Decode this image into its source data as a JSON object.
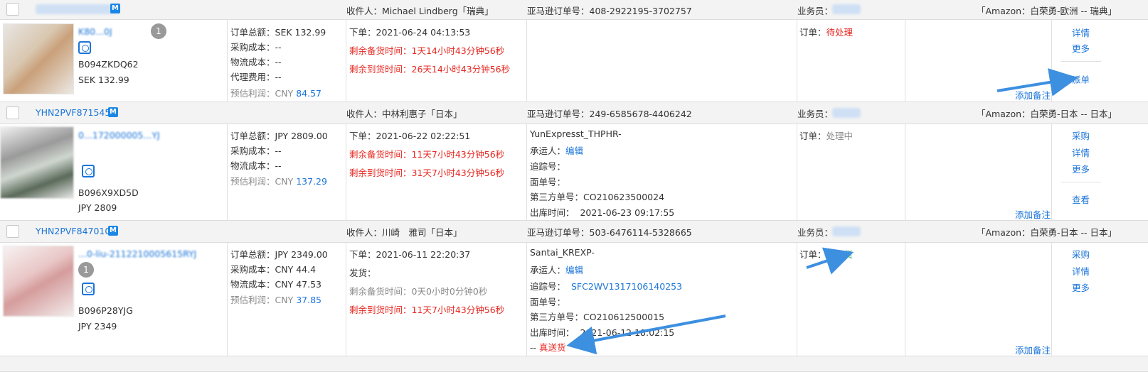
{
  "colors": {
    "link": "#1a74d8",
    "alert": "#e6261f",
    "shipped": "#3cb34a",
    "header_bg": "#f3f3f3",
    "arrow": "#3d8fe0"
  },
  "orders": [
    {
      "header": {
        "order_id": "",
        "recipient": "收件人：Michael Lindberg「瑞典」",
        "amazon_no": "亚马逊订单号：408-2922195-3702757",
        "salesman": "业务员：",
        "shop": "「Amazon：白荣勇-欧洲 -- 瑞典」"
      },
      "product": {
        "title": "K80...0J",
        "count": "1",
        "asin": "B094ZKDQ62",
        "price": "SEK 132.99"
      },
      "money": [
        {
          "label": "订单总额：",
          "value": "SEK 132.99"
        },
        {
          "label": "采购成本：",
          "value": "--"
        },
        {
          "label": "物流成本：",
          "value": "--"
        },
        {
          "label": "代理费用：",
          "value": "--"
        },
        {
          "label": "预估利润：",
          "value": "CNY ",
          "link": "84.57"
        }
      ],
      "time": [
        {
          "text": "下单：2021-06-24 04:13:53",
          "style": "normal"
        },
        {
          "text": "剩余备货时间：1天14小时43分钟56秒",
          "style": "red"
        },
        {
          "text": "剩余到货时间：26天14小时43分钟56秒",
          "style": "red"
        }
      ],
      "status": {
        "label": "订单：",
        "value": "待处理"
      },
      "actions": [
        "详情",
        "更多",
        "派单"
      ],
      "note": "添加备注"
    },
    {
      "header": {
        "order_id": "YHN2PVF871545",
        "recipient": "收件人：中林利惠子「日本」",
        "amazon_no": "亚马逊订单号：249-6585678-4406242",
        "salesman": "业务员：",
        "shop": "「Amazon：白荣勇-日本 -- 日本」"
      },
      "product": {
        "title": "0...172000005...YJ",
        "count": "",
        "asin": "B096X9XD5D",
        "price": "JPY 2809"
      },
      "money": [
        {
          "label": "订单总额：",
          "value": "JPY 2809.00"
        },
        {
          "label": "采购成本：",
          "value": "--"
        },
        {
          "label": "物流成本：",
          "value": "--"
        },
        {
          "label": "预估利润：",
          "value": "CNY ",
          "link": "137.29"
        }
      ],
      "time": [
        {
          "text": "下单：2021-06-22 02:22:51",
          "style": "normal"
        },
        {
          "text": "剩余备货时间：11天7小时43分钟56秒",
          "style": "red"
        },
        {
          "text": "剩余到货时间：31天7小时43分钟56秒",
          "style": "red"
        }
      ],
      "logistics": {
        "carrier_code": "YunExpresst_THPHR-",
        "carrier_label": "承运人：",
        "carrier_edit": "编辑",
        "tracking_label": "追踪号：",
        "tracking": "",
        "face_label": "面单号：",
        "third_label": "第三方单号：",
        "third": "CO210623500024",
        "out_label": "出库时间：",
        "out": "2021-06-23 09:17:55"
      },
      "status": {
        "label": "订单：",
        "value": "处理中"
      },
      "actions": [
        "采购",
        "详情",
        "更多",
        "查看"
      ],
      "note": "添加备注"
    },
    {
      "header": {
        "order_id": "YHN2PVF847010",
        "recipient": "收件人：川崎　雅司「日本」",
        "amazon_no": "亚马逊订单号：503-6476114-5328665",
        "salesman": "业务员：",
        "shop": "「Amazon：白荣勇-日本 -- 日本」"
      },
      "product": {
        "title": "...0-liu-2112210005615RYJ",
        "count": "1",
        "asin": "B096P28YJG",
        "price": "JPY 2349"
      },
      "money": [
        {
          "label": "订单总额：",
          "value": "JPY 2349.00"
        },
        {
          "label": "采购成本：",
          "value": "CNY 44.4"
        },
        {
          "label": "物流成本：",
          "value": "CNY 47.53"
        },
        {
          "label": "预估利润：",
          "value": "CNY ",
          "link": "37.85"
        }
      ],
      "time": [
        {
          "text": "下单：2021-06-11 22:20:37",
          "style": "normal"
        },
        {
          "text": "发货：",
          "style": "normal"
        },
        {
          "text": "剩余备货时间：0天0小时0分钟0秒",
          "style": "gray"
        },
        {
          "text": "剩余到货时间：11天7小时43分钟56秒",
          "style": "red"
        }
      ],
      "logistics": {
        "carrier_code": "Santai_KREXP-",
        "carrier_label": "承运人：",
        "carrier_edit": "编辑",
        "tracking_label": "追踪号：",
        "tracking": "SFC2WV1317106140253",
        "face_label": "面单号：",
        "third_label": "第三方单号：",
        "third": "CO210612500015",
        "out_label": "出库时间：",
        "out": "2021-06-12 18:02:15",
        "direct_prefix": "-- ",
        "direct": "真送货"
      },
      "status": {
        "label": "订单：",
        "value": "已发货"
      },
      "actions": [
        "采购",
        "详情",
        "更多"
      ],
      "note": "添加备注"
    }
  ]
}
